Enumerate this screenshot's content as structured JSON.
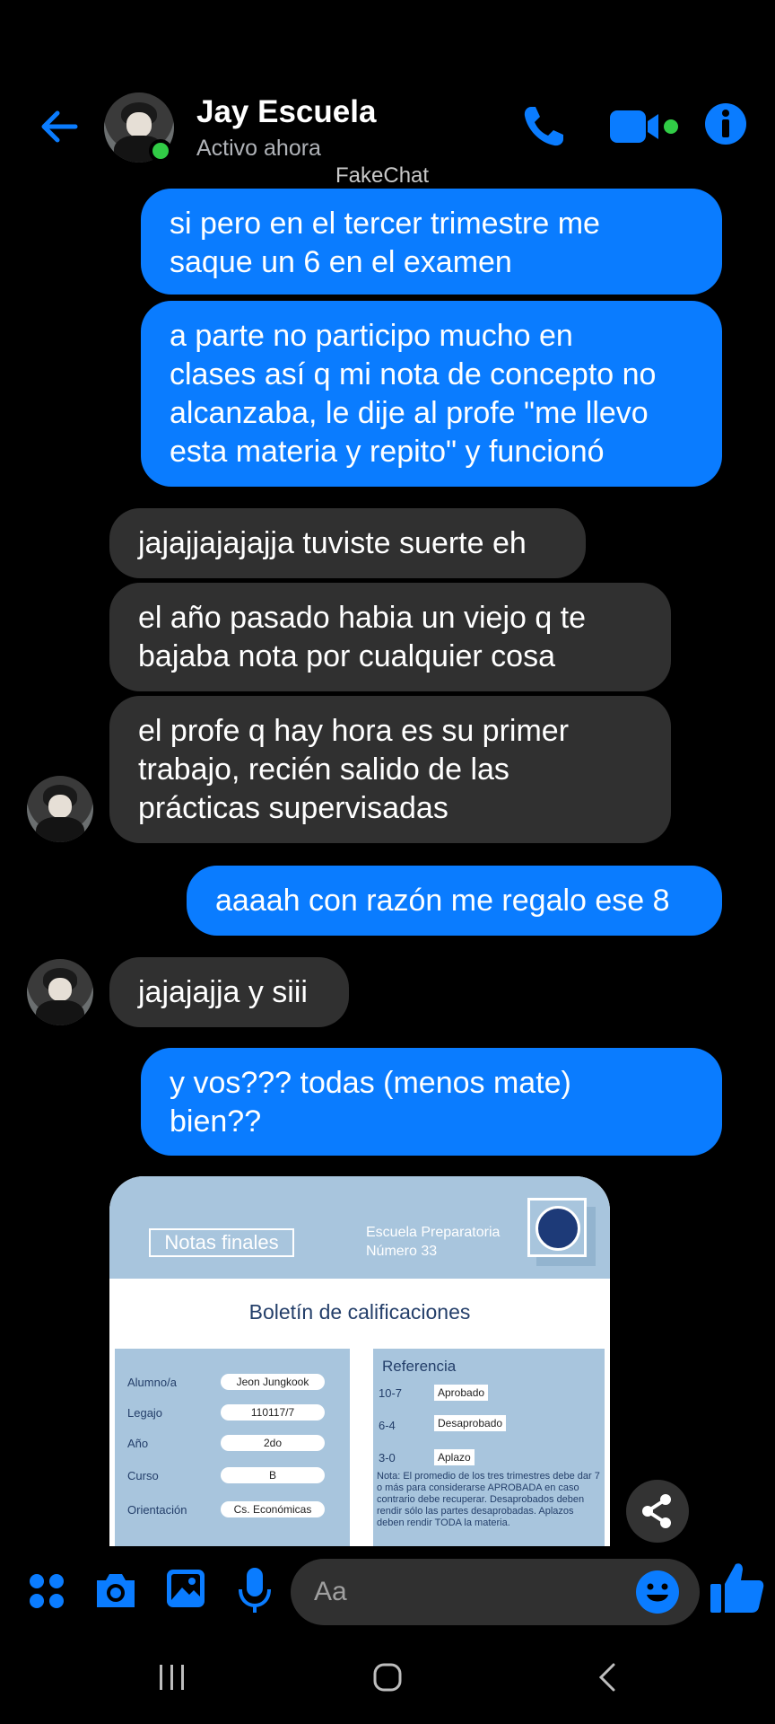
{
  "header": {
    "contact_name": "Jay Escuela",
    "status": "Activo ahora"
  },
  "watermark": "FakeChat",
  "messages": [
    {
      "side": "out",
      "text_lines": [
        "si pero en el tercer trimestre me",
        "saque un 6 en el examen"
      ]
    },
    {
      "side": "out",
      "text_lines": [
        "a parte no participo mucho en",
        "clases así q mi nota de concepto no",
        "alcanzaba, le dije al profe \"me llevo",
        "esta materia y repito\" y funcionó"
      ]
    },
    {
      "side": "in",
      "text_lines": [
        "jajajjajajajja tuviste suerte eh"
      ]
    },
    {
      "side": "in",
      "text_lines": [
        "el año pasado habia un viejo q te",
        "bajaba nota por cualquier cosa"
      ]
    },
    {
      "side": "in",
      "text_lines": [
        "el profe q hay hora es su primer",
        "trabajo, recién salido de las",
        "prácticas supervisadas"
      ]
    },
    {
      "side": "out",
      "text_lines": [
        "aaaah con razón me regalo ese 8"
      ]
    },
    {
      "side": "in",
      "text_lines": [
        "jajajajja y siii"
      ]
    },
    {
      "side": "out",
      "text_lines": [
        "y vos??? todas (menos mate)",
        "bien??"
      ]
    }
  ],
  "image_card": {
    "notas_title": "Notas finales",
    "school_line1": "Escuela Preparatoria",
    "school_line2": "Número 33",
    "doc_title": "Boletín de calificaciones",
    "fields": [
      {
        "label": "Alumno/a",
        "value": "Jeon Jungkook"
      },
      {
        "label": "Legajo",
        "value": "110117/7"
      },
      {
        "label": "Año",
        "value": "2do"
      },
      {
        "label": "Curso",
        "value": "B"
      },
      {
        "label": "Orientación",
        "value": "Cs. Económicas"
      }
    ],
    "reference_title": "Referencia",
    "reference_rows": [
      {
        "range": "10-7",
        "label": "Aprobado"
      },
      {
        "range": "6-4",
        "label": "Desaprobado"
      },
      {
        "range": "3-0",
        "label": "Aplazo"
      }
    ],
    "note": "Nota: El promedio de los tres trimestres debe dar 7 o más para considerarse APROBADA en caso contrario debe recuperar. Desaprobados deben rendir sólo las partes desaprobadas. Aplazos deben rendir TODA la materia."
  },
  "composer": {
    "placeholder": "Aa"
  },
  "colors": {
    "accent": "#0a7cff",
    "incoming_bubble": "#303030",
    "online": "#31cc46",
    "background": "#000000"
  },
  "icons": [
    "back-arrow-icon",
    "phone-icon",
    "video-camera-icon",
    "info-icon",
    "apps-icon",
    "camera-icon",
    "gallery-icon",
    "microphone-icon",
    "emoji-icon",
    "thumbs-up-icon",
    "share-icon",
    "recent-apps-icon",
    "home-icon",
    "back-icon"
  ]
}
